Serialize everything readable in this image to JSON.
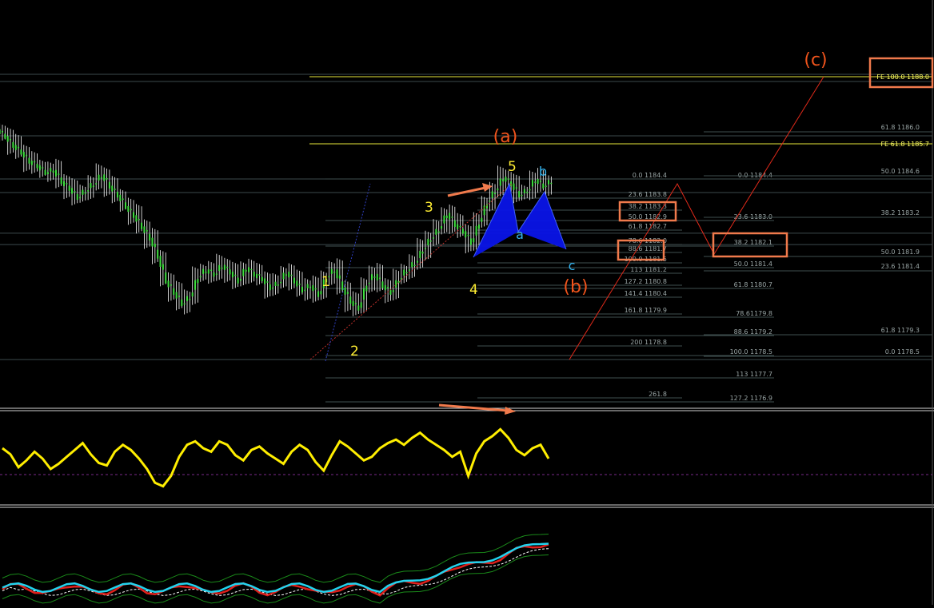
{
  "chart_data": {
    "type": "line",
    "title": "",
    "main_panel": {
      "candles_close": [
        1186.3,
        1185.9,
        1185.6,
        1185.2,
        1185.0,
        1184.7,
        1184.8,
        1184.3,
        1184.0,
        1183.6,
        1183.9,
        1184.2,
        1184.6,
        1184.1,
        1183.7,
        1183.2,
        1182.8,
        1182.3,
        1181.8,
        1181.0,
        1179.9,
        1179.4,
        1178.9,
        1179.2,
        1180.1,
        1180.4,
        1180.2,
        1180.6,
        1180.3,
        1179.9,
        1180.5,
        1180.2,
        1180.0,
        1179.6,
        1179.8,
        1180.3,
        1179.9,
        1179.5,
        1179.7,
        1179.3,
        1180.1,
        1180.4,
        1179.6,
        1179.0,
        1178.7,
        1179.8,
        1180.2,
        1179.7,
        1179.4,
        1180.0,
        1180.4,
        1180.7,
        1181.3,
        1181.8,
        1182.2,
        1182.9,
        1182.4,
        1182.1,
        1181.6,
        1182.5,
        1183.4,
        1183.9,
        1184.5,
        1184.2,
        1183.7,
        1183.9,
        1184.4,
        1184.1,
        1184.3
      ],
      "fibonacci_levels_1": [
        {
          "label": "0.0 1184.4",
          "price": 1184.4
        },
        {
          "label": "23.6 1183.8",
          "price": 1183.8
        },
        {
          "label": "38.2 1183.3",
          "price": 1183.3
        },
        {
          "label": "50.0 1182.9",
          "price": 1182.9
        },
        {
          "label": "61.8 1182.7",
          "price": 1182.7
        },
        {
          "label": "78.6 1182.0",
          "price": 1182.0
        },
        {
          "label": "88.6 1181.7",
          "price": 1181.7
        },
        {
          "label": "100.0 1181.5",
          "price": 1181.5
        },
        {
          "label": "113 1181.2",
          "price": 1181.2
        },
        {
          "label": "127.2 1180.8",
          "price": 1180.8
        },
        {
          "label": "141.4 1180.4",
          "price": 1180.4
        },
        {
          "label": "161.8 1179.9",
          "price": 1179.9
        },
        {
          "label": "200 1178.8",
          "price": 1178.8
        },
        {
          "label": "261.8",
          "price": 1177.1
        }
      ],
      "fibonacci_levels_2": [
        {
          "label": "0.0 1184.4",
          "price": 1184.4
        },
        {
          "label": "23.6 1183.0",
          "price": 1183.0
        },
        {
          "label": "38.2 1182.1",
          "price": 1182.1
        },
        {
          "label": "50.0 1181.4",
          "price": 1181.4
        },
        {
          "label": "61.8 1180.7",
          "price": 1180.7
        },
        {
          "label": "78.61179.8",
          "price": 1179.8
        },
        {
          "label": "88.6 1179.2",
          "price": 1179.2
        },
        {
          "label": "100.0 1178.5",
          "price": 1178.5
        },
        {
          "label": "113 1177.7",
          "price": 1177.7
        },
        {
          "label": "127.2 1176.9",
          "price": 1176.9
        }
      ],
      "fibonacci_levels_3": [
        {
          "label": "61.8 1186.0",
          "price": 1186.0
        },
        {
          "label": "50.0 1184.6",
          "price": 1184.6
        },
        {
          "label": "38.2 1183.2",
          "price": 1183.2
        },
        {
          "label": "50.0 1181.9",
          "price": 1181.9
        },
        {
          "label": "23.6 1181.4",
          "price": 1181.4
        },
        {
          "label": "61.8 1179.3",
          "price": 1179.3
        },
        {
          "label": "0.0 1178.5",
          "price": 1178.5
        }
      ],
      "fe_levels": [
        {
          "label": "FE 100.0 1188.0",
          "price": 1188.0
        },
        {
          "label": "FE 61.8 1185.7",
          "price": 1185.7
        }
      ],
      "wave_labels_yellow": [
        "1",
        "2",
        "3",
        "4",
        "5"
      ],
      "wave_labels_blue": [
        "a",
        "b",
        "c"
      ],
      "wave_labels_orange": [
        "(a)",
        "(b)",
        "(c)"
      ],
      "projection_path_prices": [
        1184.4,
        1182.1,
        1188.0
      ],
      "harmonic_pattern_color": "#0a14e8"
    },
    "oscillator_panel": {
      "values": [
        62,
        55,
        40,
        48,
        58,
        50,
        38,
        44,
        52,
        60,
        68,
        55,
        45,
        42,
        58,
        66,
        60,
        50,
        38,
        22,
        18,
        30,
        52,
        66,
        70,
        62,
        58,
        70,
        66,
        54,
        48,
        60,
        64,
        56,
        50,
        44,
        58,
        66,
        60,
        46,
        36,
        54,
        70,
        64,
        56,
        48,
        52,
        62,
        68,
        72,
        66,
        74,
        80,
        72,
        66,
        60,
        52,
        58,
        30,
        56,
        70,
        76,
        84,
        74,
        60,
        54,
        62,
        66,
        50
      ],
      "color": "#ffee00"
    },
    "lower_panel": {
      "series": [
        {
          "color": "#22d3ee"
        },
        {
          "color": "#e0201c"
        },
        {
          "color": "#ffffff"
        },
        {
          "color": "#1a8a1a"
        }
      ]
    }
  }
}
